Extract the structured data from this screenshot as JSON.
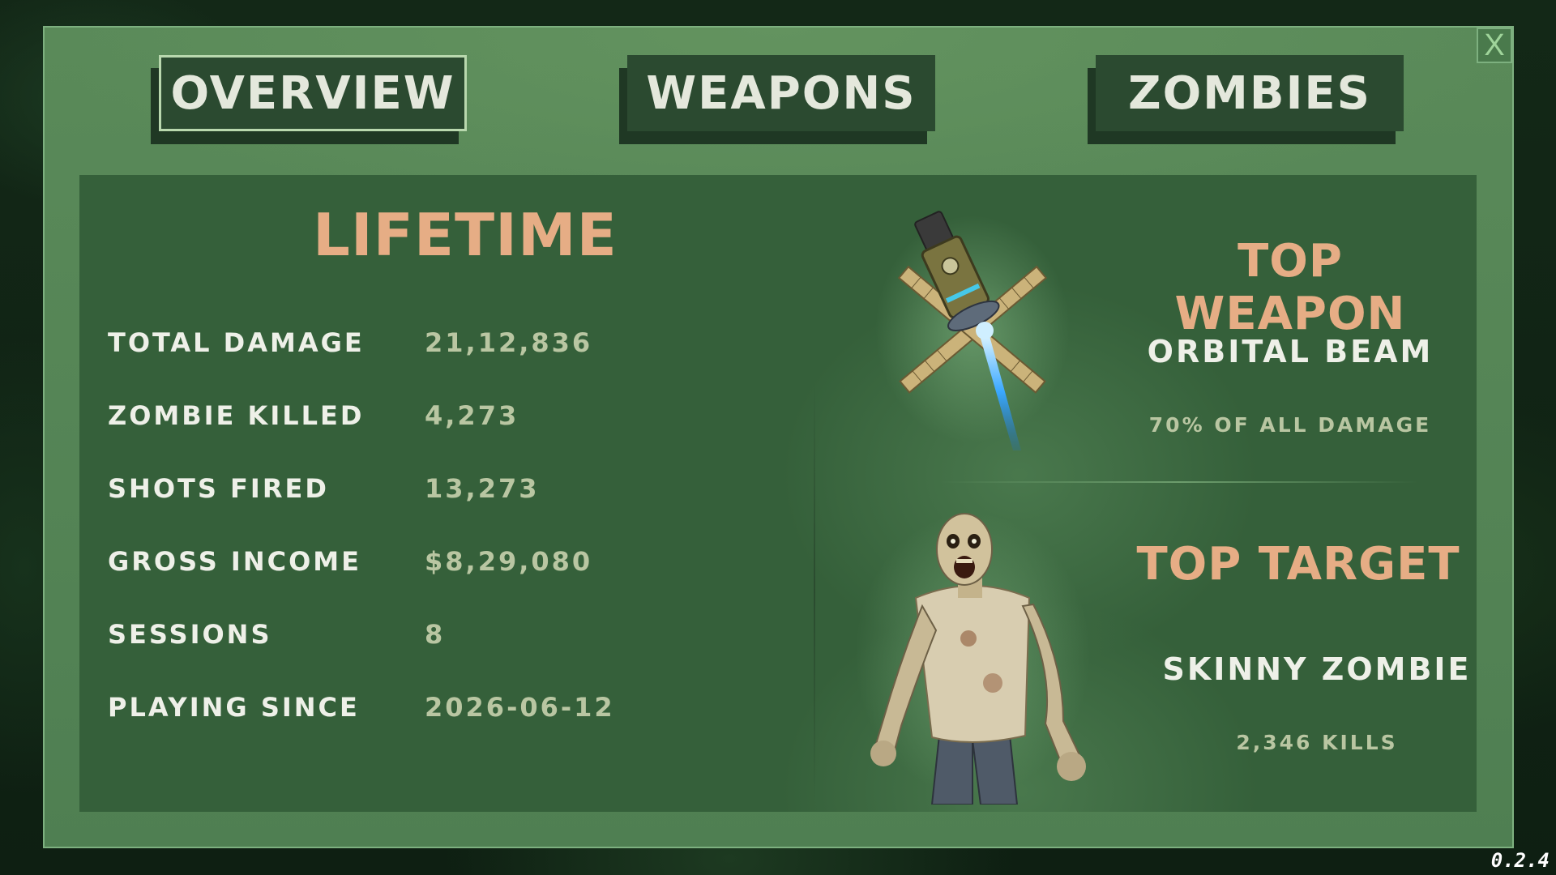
{
  "tabs": [
    {
      "label": "OVERVIEW",
      "active": true
    },
    {
      "label": "WEAPONS",
      "active": false
    },
    {
      "label": "ZOMBIES",
      "active": false
    }
  ],
  "close_label": "X",
  "lifetime": {
    "title": "LIFETIME",
    "stats": [
      {
        "label": "TOTAL DAMAGE",
        "value": "21,12,836"
      },
      {
        "label": "ZOMBIE KILLED",
        "value": "4,273"
      },
      {
        "label": "SHOTS FIRED",
        "value": "13,273"
      },
      {
        "label": "GROSS INCOME",
        "value": "$8,29,080"
      },
      {
        "label": "SESSIONS",
        "value": "8"
      },
      {
        "label": "PLAYING SINCE",
        "value": "2026-06-12"
      }
    ]
  },
  "top_weapon": {
    "heading": "TOP WEAPON",
    "name": "ORBITAL BEAM",
    "detail": "70% OF ALL DAMAGE",
    "icon": "orbital-beam-satellite-icon"
  },
  "top_target": {
    "heading": "TOP TARGET",
    "name": "SKINNY ZOMBIE",
    "detail": "2,346 KILLS",
    "icon": "skinny-zombie-icon"
  },
  "version": "0.2.4",
  "colors": {
    "accent_orange": "#e6ad85",
    "value_green": "#b9c6a2",
    "panel_green": "#35603a",
    "frame_green": "#5a8a59",
    "tab_dark": "#2b4a30"
  }
}
